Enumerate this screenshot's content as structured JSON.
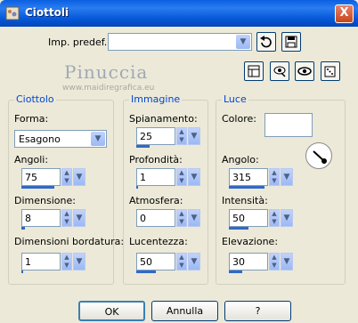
{
  "window": {
    "title": "Ciottoli",
    "close_label": "X"
  },
  "preset": {
    "label": "Imp. predef.:",
    "value": ""
  },
  "watermark": {
    "title": "Pinuccia",
    "url": "www.maidiregrafica.eu"
  },
  "groups": {
    "ciottolo": {
      "title": "Ciottolo",
      "forma_label": "Forma:",
      "forma_value": "Esagono",
      "angoli_label": "Angoli:",
      "angoli_value": "75",
      "angoli_level": 0.85,
      "dimensione_label": "Dimensione:",
      "dimensione_value": "8",
      "dimensione_level": 0.1,
      "bordatura_label": "Dimensioni bordatura:",
      "bordatura_value": "1",
      "bordatura_level": 0.05
    },
    "immagine": {
      "title": "Immagine",
      "spianamento_label": "Spianamento:",
      "spianamento_value": "25",
      "spianamento_level": 0.35,
      "profondita_label": "Profondità:",
      "profondita_value": "1",
      "profondita_level": 0.05,
      "atmosfera_label": "Atmosfera:",
      "atmosfera_value": "0",
      "atmosfera_level": 0.0,
      "lucentezza_label": "Lucentezza:",
      "lucentezza_value": "50",
      "lucentezza_level": 0.5
    },
    "luce": {
      "title": "Luce",
      "colore_label": "Colore:",
      "colore_value": "#ffffff",
      "angolo_label": "Angolo:",
      "angolo_value": "315",
      "angolo_level": 0.9,
      "intensita_label": "Intensità:",
      "intensita_value": "50",
      "intensita_level": 0.5,
      "elevazione_label": "Elevazione:",
      "elevazione_value": "30",
      "elevazione_level": 0.35
    }
  },
  "buttons": {
    "ok": "OK",
    "annulla": "Annulla",
    "help": "?"
  }
}
